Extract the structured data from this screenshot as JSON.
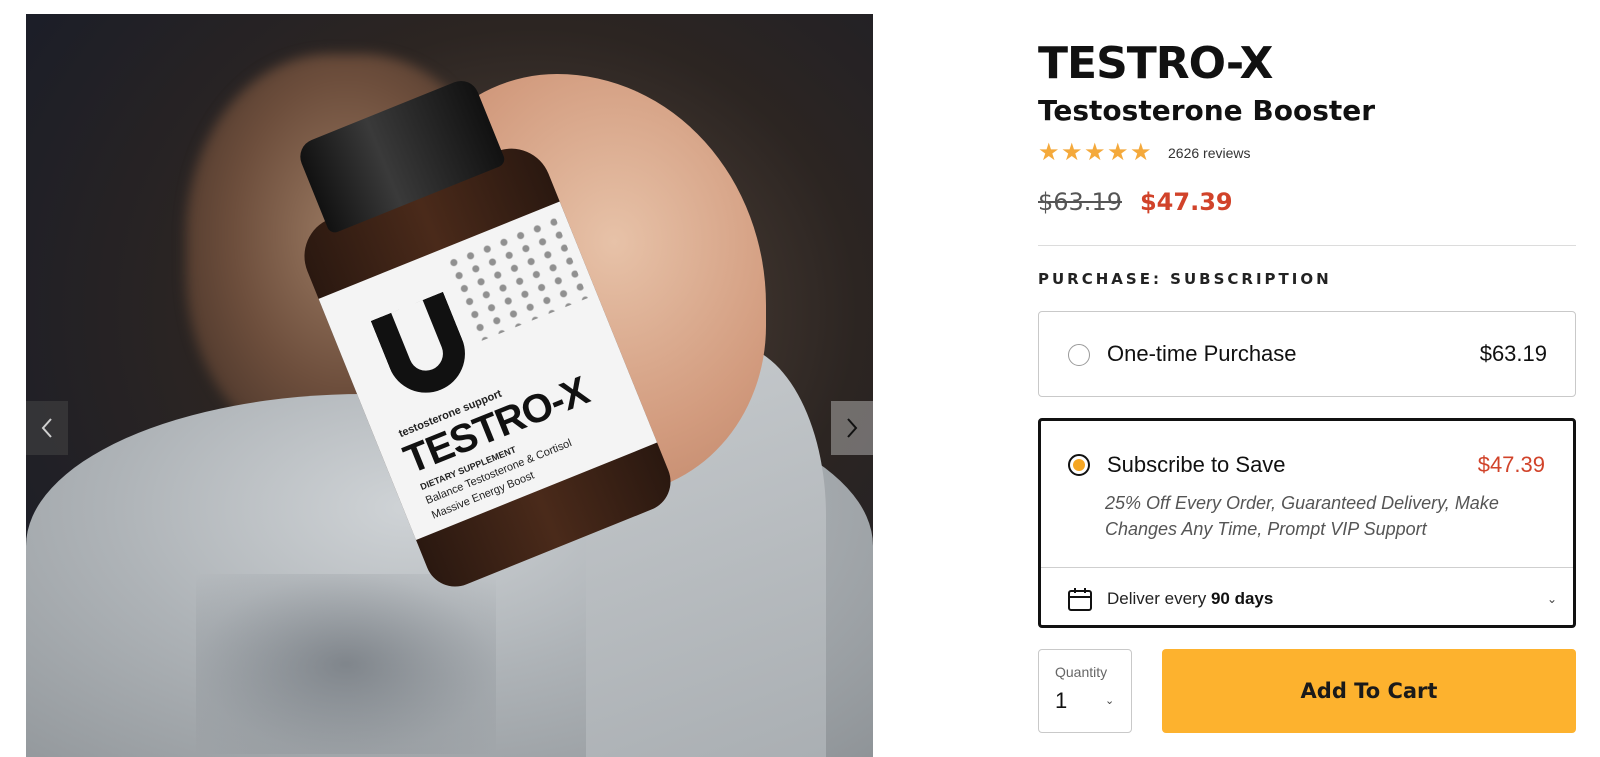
{
  "product": {
    "title": "TESTRO-X",
    "subtitle": "Testosterone Booster",
    "rating_stars": 5,
    "review_count": "2626 reviews",
    "price_original": "$63.19",
    "price_sale": "$47.39"
  },
  "bottle_label": {
    "tagline": "testosterone support",
    "name": "TESTRO-X",
    "type": "DIETARY SUPPLEMENT",
    "line1": "Balance Testosterone & Cortisol",
    "line2": "Massive Energy Boost"
  },
  "purchase": {
    "label": "PURCHASE: SUBSCRIPTION",
    "options": [
      {
        "title": "One-time Purchase",
        "price": "$63.19",
        "selected": false
      },
      {
        "title": "Subscribe to Save",
        "price": "$47.39",
        "selected": true,
        "description": "25% Off Every Order, Guaranteed Delivery, Make Changes Any Time, Prompt VIP Support",
        "deliver_prefix": "Deliver every",
        "deliver_value": "90 days"
      }
    ]
  },
  "cart": {
    "quantity_label": "Quantity",
    "quantity_value": "1",
    "add_to_cart_label": "Add To Cart"
  },
  "colors": {
    "accent": "#fdb22e",
    "sale": "#d1432a",
    "star": "#f4a93b"
  },
  "icons": {
    "gallery_prev": "chevron-left-icon",
    "gallery_next": "chevron-right-icon",
    "star": "star-icon",
    "calendar": "calendar-icon",
    "dropdown": "chevron-down-icon"
  }
}
